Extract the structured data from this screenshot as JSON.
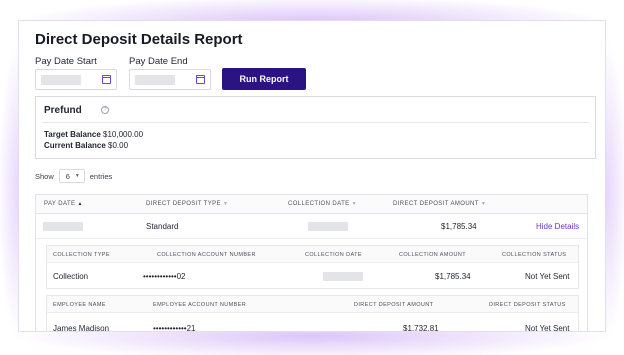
{
  "page_title": "Direct Deposit Details Report",
  "filters": {
    "start_label": "Pay Date Start",
    "end_label": "Pay Date End",
    "run_button": "Run Report"
  },
  "prefund": {
    "title": "Prefund",
    "info_icon": "info-icon",
    "target_label": "Target Balance",
    "target_value": "$10,000.00",
    "current_label": "Current Balance",
    "current_value": "$0.00"
  },
  "entries": {
    "show_label": "Show",
    "value": "6",
    "suffix": "entries"
  },
  "table": {
    "columns": [
      "PAY DATE",
      "DIRECT DEPOSIT TYPE",
      "COLLECTION DATE",
      "DIRECT DEPOSIT AMOUNT"
    ],
    "row": {
      "type": "Standard",
      "amount": "$1,785.34",
      "action": "Hide Details"
    }
  },
  "collection": {
    "columns": [
      "COLLECTION TYPE",
      "COLLECTION ACCOUNT NUMBER",
      "COLLECTION DATE",
      "COLLECTION AMOUNT",
      "COLLECTION STATUS"
    ],
    "row": {
      "type": "Collection",
      "account": "••••••••••••02",
      "amount": "$1,785.34",
      "status": "Not Yet Sent"
    }
  },
  "employees": {
    "columns": [
      "EMPLOYEE NAME",
      "EMPLOYEE ACCOUNT NUMBER",
      "DIRECT DEPOSIT AMOUNT",
      "DIRECT DEPOSIT STATUS"
    ],
    "row": {
      "name": "James Madison",
      "account": "••••••••••••21",
      "amount": "$1,732.81",
      "status": "Not Yet Sent"
    }
  },
  "colors": {
    "primary": "#2b1383",
    "link": "#6b35c8",
    "calendar_icon": "#7a3fd0"
  }
}
